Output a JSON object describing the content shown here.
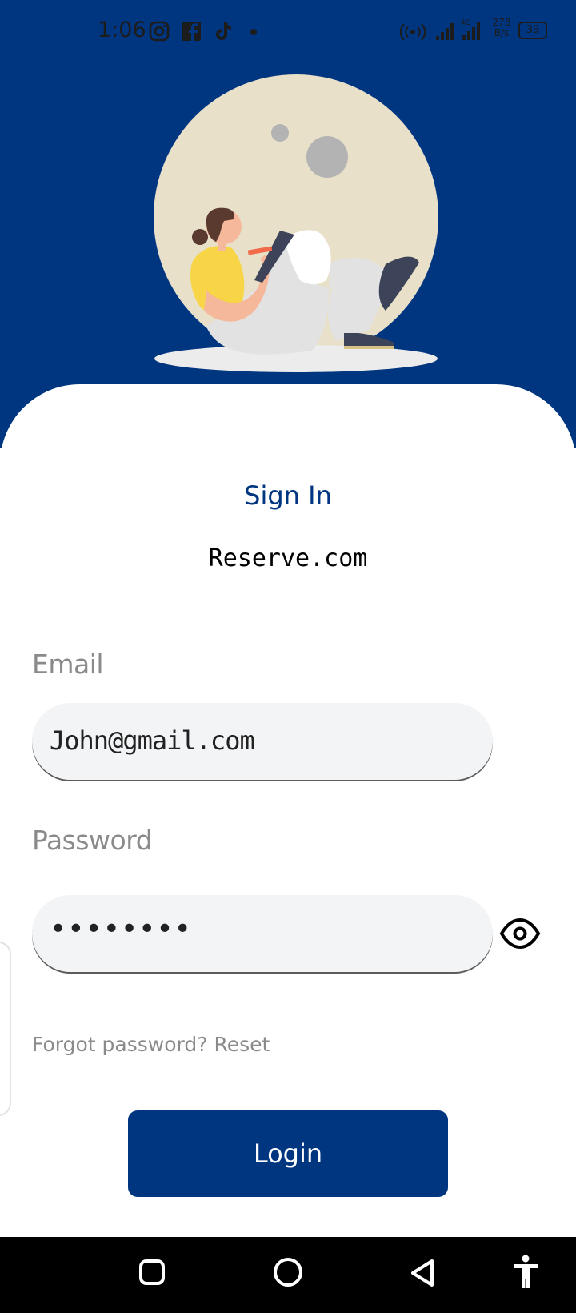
{
  "status_bar": {
    "time": "1:06",
    "app_icons": [
      "instagram-icon",
      "facebook-icon",
      "tiktok-icon",
      "dot-icon"
    ],
    "right_icons": [
      "hotspot-icon",
      "signal-icon",
      "4g-signal-icon"
    ],
    "network_speed_top": "278",
    "network_speed_bottom": "B/s",
    "battery_level": "39"
  },
  "login": {
    "title": "Sign In",
    "brand": "Reserve.com",
    "email_label": "Email",
    "email_value": "John@gmail.com",
    "password_label": "Password",
    "password_value": "••••••••",
    "forgot_text": "Forgot password? Reset",
    "login_button": "Login"
  },
  "nav_bar": {
    "icons": [
      "recents-icon",
      "home-icon",
      "back-icon",
      "accessibility-icon"
    ]
  },
  "colors": {
    "brand_blue": "#003580",
    "input_bg": "#f3f4f6",
    "label_gray": "#8a8a8a"
  }
}
